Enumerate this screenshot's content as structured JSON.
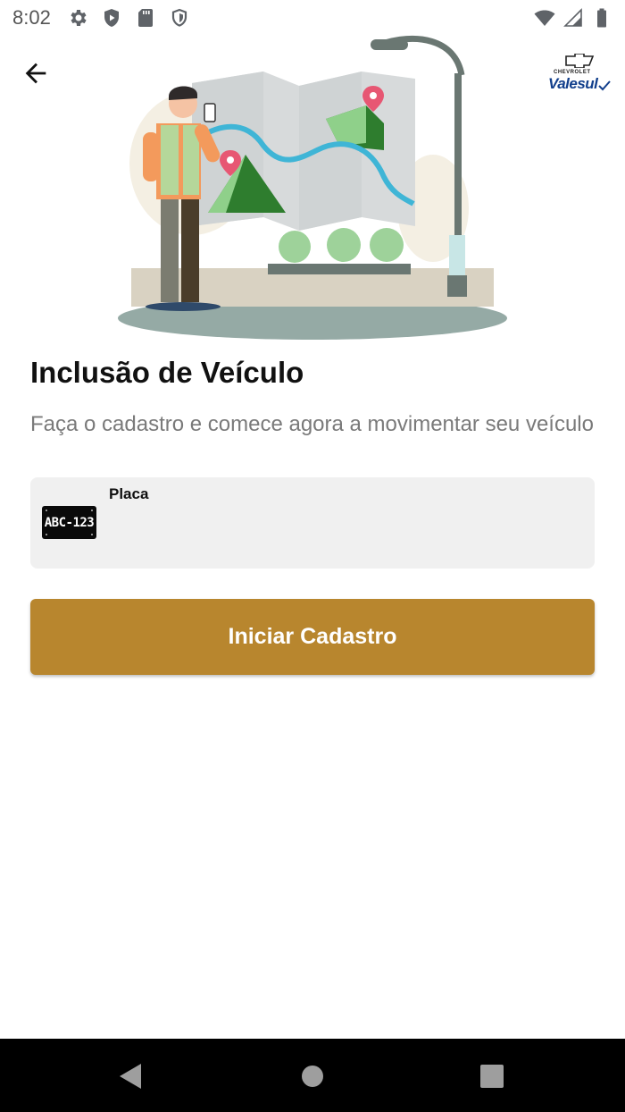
{
  "status_bar": {
    "time": "8:02",
    "left_icons": [
      "gear-icon",
      "play-shield-icon",
      "sd-card-icon",
      "shield-icon"
    ],
    "right_icons": [
      "wifi-icon",
      "signal-icon",
      "battery-icon"
    ]
  },
  "header": {
    "back_icon": "arrow-left-icon",
    "brand": {
      "maker": "CHEVROLET",
      "dealer": "Valesul"
    }
  },
  "illustration": {
    "subject": "man-with-phone-and-city-map"
  },
  "main": {
    "title": "Inclusão de Veículo",
    "subtitle": "Faça o cadastro e comece agora a movimentar seu veículo",
    "plate_field": {
      "label": "Placa",
      "badge_text": "ABC-123",
      "value": "",
      "placeholder": ""
    },
    "primary_button": {
      "label": "Iniciar Cadastro"
    }
  },
  "nav_bar": {
    "items": [
      "back-triangle-icon",
      "home-circle-icon",
      "recents-square-icon"
    ]
  },
  "colors": {
    "accent": "#b8862e",
    "field_bg": "#f0f0f0",
    "title": "#111111",
    "subtitle": "#7a7a7a",
    "brand_blue": "#123f8c"
  }
}
